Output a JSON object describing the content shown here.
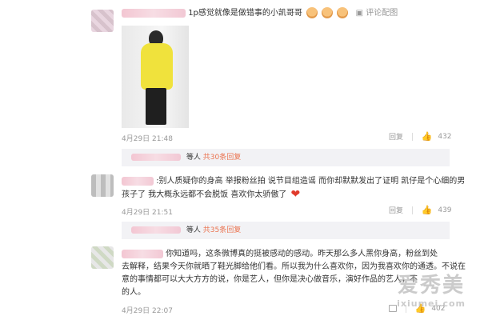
{
  "comments": [
    {
      "text": "1p感觉就像是做错事的小凯哥哥",
      "reaction_link": "评论配图",
      "emoji_icons": [
        "cute-face-emoji",
        "cute-face-emoji",
        "cute-face-emoji"
      ],
      "has_image": true,
      "date": "4月29日 21:48",
      "reply_label": "回复",
      "likes": "432",
      "replies_prefix": "等人",
      "replies_link": "共30条回复"
    },
    {
      "text_line1": ":别人质疑你的身高 举报粉丝拍 说节目组造谣 而你却默默发出了证明 凯仔是个心细的男",
      "text_line2": "孩子了 我大概永远都不会脱饭 喜欢你太骄傲了",
      "date": "4月29日 21:51",
      "reply_label": "回复",
      "likes": "439",
      "replies_prefix": "等人",
      "replies_link": "共35条回复"
    },
    {
      "text_line1": "你知道吗，这条微博真的挺被感动的感动。昨天那么多人黑你身高，粉丝到处",
      "text_line2": "去解释，结果今天你就晒了鞋光脚给他们看。所以我为什么喜欢你，因为我喜欢你的通透。不说在",
      "text_line3": "意的事情都可以大大方方的说，你是艺人，但你是决心做音乐，演好作品的艺人，不",
      "text_line4": "的人。",
      "date": "4月29日 22:07",
      "likes": "402"
    }
  ],
  "watermark": {
    "main": "爱秀美",
    "sub": "ixiumei.com"
  }
}
